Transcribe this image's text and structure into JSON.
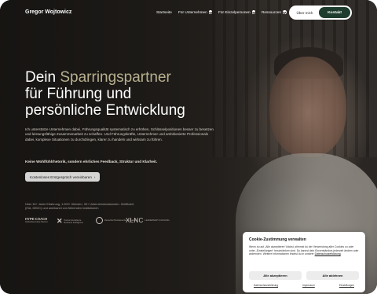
{
  "header": {
    "brand": "Gregor Wojtowicz",
    "nav": [
      {
        "label": "Startseite"
      },
      {
        "label": "Für Unternehmen"
      },
      {
        "label": "Für Einzelpersonen"
      },
      {
        "label": "Ressourcen"
      }
    ],
    "about_label": "Über mich",
    "contact_label": "Kontakt"
  },
  "hero": {
    "headline_prefix": "Dein ",
    "headline_accent": "Sparringspartner",
    "headline_line2": "für Führung und",
    "headline_line3": "persönliche Entwicklung",
    "intro": "Ich unterstütze Unternehmen dabei, Führungsqualität systematisch zu erhöhen, Schlüsselpositionen besser zu besetzen und leistungsfähige Zusammenarbeit zu schaffen. Und Führungskräfte, Unternehmer und ambitionierte Professionals dabei, komplexe Situationen zu durchdringen, klarer zu handeln und wirksam zu führen.",
    "tagline": "Keine Wohlfühlrhetorik, sondern ehrliches Feedback, Struktur und Klarheit.",
    "cta_label": "Kostenloses Erstgespräch vereinbaren",
    "cta_arrow": "›",
    "experience": "Über 15+ Jahre Erfahrung, 1.000+ Klienten, 30+ Unternehmenskunden. Zertifiziert (ISA, DBVC) und anerkannt von führenden Institutionen"
  },
  "logos": [
    {
      "name": "HYPE-COACH",
      "sub": "Global Executive Partner"
    },
    {
      "name": "Partner Excellence",
      "sub": "Business Intelligence"
    },
    {
      "name": "Deutscher Bundesverband Coaching",
      "sub": ""
    },
    {
      "name": "XLNC",
      "sub": "LEADERSHIP COACHING"
    }
  ],
  "cookie": {
    "title": "Cookie-Zustimmung verwalten",
    "text": "Wenn du auf „Alle akzeptieren“ klickst, stimmst du der Verwendung aller Cookies zu oder unter „Einstellungen“ beschränken sind. Du kannst dein Einverständnis jederzeit ändern oder widerrufen. Weitere Informationen findest du in unserer ",
    "policy_link": "Datenschutzerklärung",
    "accept_label": "Alle akzeptieren",
    "reject_label": "Alle ablehnen",
    "footer_links": [
      "Datenschutzerklärung",
      "Impressum",
      "Einstellungen"
    ]
  }
}
